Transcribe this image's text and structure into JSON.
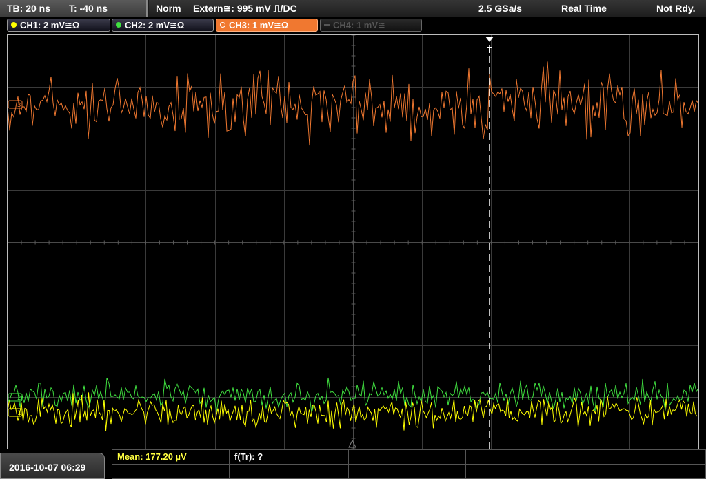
{
  "timebase": {
    "tb": "TB: 20 ns",
    "t": "T: -40 ns"
  },
  "status": {
    "mode": "Norm",
    "trigger": "Extern≅: 995 mV ⎍/DC",
    "sample_rate": "2.5 GSa/s",
    "acq": "Real Time",
    "state": "Not Rdy."
  },
  "channels": [
    {
      "label": "CH1: 2 mV≅Ω",
      "color": "#ffff00",
      "state": "on"
    },
    {
      "label": "CH2: 2 mV≅Ω",
      "color": "#40e040",
      "state": "on"
    },
    {
      "label": "CH3: 1 mV≅Ω",
      "color": "#f07830",
      "state": "active"
    },
    {
      "label": "CH4: 1 mV≅",
      "color": "#555555",
      "state": "off"
    }
  ],
  "markers": {
    "ch3": "3",
    "ch2": "2",
    "ch1": "1",
    "trigger": "T"
  },
  "measurement": {
    "mean": "Mean: 177.20 µV",
    "ftr": "f(Tr): ?"
  },
  "datetime": "2016-10-07 06:29"
}
